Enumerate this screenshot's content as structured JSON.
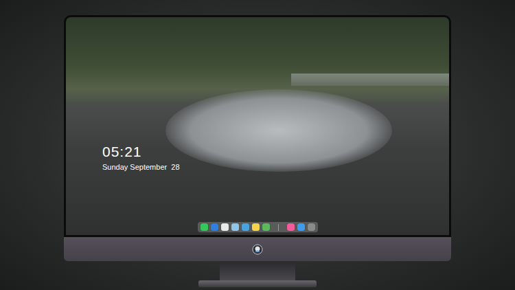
{
  "lock_screen": {
    "time": "05:21",
    "date": "Sunday September  28"
  },
  "dock": {
    "apps": [
      {
        "color": "#34c759"
      },
      {
        "color": "#2f7fe0"
      },
      {
        "color": "#e9e9e9"
      },
      {
        "color": "#8ec5e8"
      },
      {
        "color": "#4aa3df"
      },
      {
        "color": "#f5d547"
      },
      {
        "color": "#5cb85c"
      }
    ],
    "recent": [
      {
        "color": "#f25c9a"
      },
      {
        "color": "#3b9cf0"
      },
      {
        "color": "#8a8a8a"
      }
    ]
  }
}
